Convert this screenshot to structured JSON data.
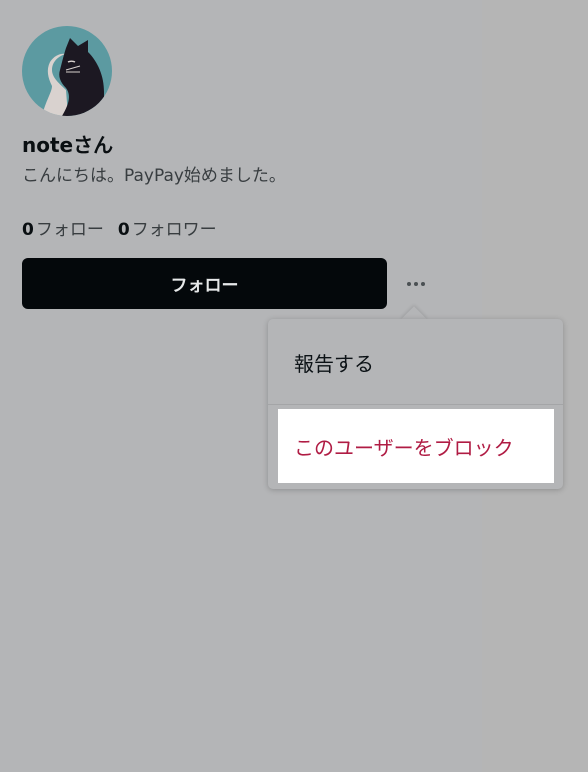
{
  "profile": {
    "name": "noteさん",
    "bio": "こんにちは。PayPay始めました。",
    "following_count": "0",
    "following_label": "フォロー",
    "followers_count": "0",
    "followers_label": "フォロワー"
  },
  "actions": {
    "follow_label": "フォロー"
  },
  "menu": {
    "items": [
      {
        "label": "報告する"
      },
      {
        "label": "このユーザーをブロック"
      }
    ]
  },
  "colors": {
    "overlay_bg": "#b4b5b7",
    "follow_button_bg": "#04080b",
    "block_text": "#b01c44",
    "avatar_bg": "#5c9aa1",
    "cat": "#1c1822"
  },
  "icons": {
    "avatar": "black-cat-avatar",
    "more": "more-horizontal-icon"
  }
}
